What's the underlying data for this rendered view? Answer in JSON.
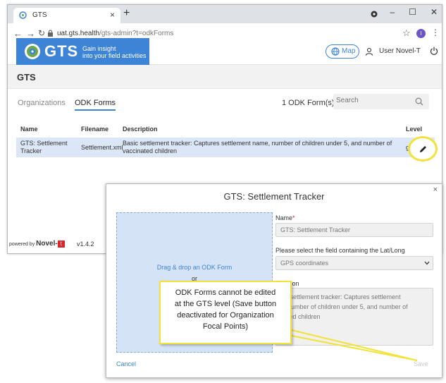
{
  "browser": {
    "tab_title": "GTS",
    "url_host": "uat.gts.health",
    "url_path": "/gts-admin?t=odkForms",
    "profile_initial": "I"
  },
  "header": {
    "brand": "GTS",
    "tagline_1": "Gain insight",
    "tagline_2": "into your field activities",
    "map_label": "Map",
    "user_label": "User Novel-T"
  },
  "page": {
    "title": "GTS",
    "tabs": [
      "Organizations",
      "ODK Forms"
    ],
    "active_tab": "ODK Forms",
    "count_label": "1 ODK Form(s)",
    "search_placeholder": "Search"
  },
  "table": {
    "headers": [
      "Name",
      "Filename",
      "Description",
      "Level"
    ],
    "rows": [
      {
        "name_1": "GTS: Settlement",
        "name_2": "Tracker",
        "filename": "Settlement.xml",
        "desc_1": "Basic settlement tracker: Captures settlement name, number of children under 5, and number of",
        "desc_2": "vaccinated children",
        "level": "gts"
      }
    ]
  },
  "footer": {
    "powered_by": "powered by",
    "brand": "Novel-",
    "brand_mark": "t",
    "version": "v1.4.2"
  },
  "modal": {
    "title": "GTS: Settlement Tracker",
    "dropzone_text": "Drag & drop an ODK Form",
    "dropzone_or": "or",
    "name_label": "Name",
    "name_value": "GTS: Settlement Tracker",
    "field_label": "Please select the field containing the Lat/Long",
    "field_value": "GPS coordinates",
    "desc_label": "scription",
    "desc_1": "sic settlement tracker: Captures settlement",
    "desc_2": "e, number of children under 5, and number of",
    "desc_3": "nated children",
    "cancel_label": "Cancel",
    "save_label": "Save",
    "close_icon": "×"
  },
  "callout": {
    "line_1": "ODK Forms cannot be edited",
    "line_2": "at the GTS level (Save button",
    "line_3": "deactivated for Organization",
    "line_4": "Focal Points)"
  },
  "colors": {
    "accent": "#3d84d6",
    "highlight": "#f2e23a",
    "brand_red": "#d9262c"
  }
}
